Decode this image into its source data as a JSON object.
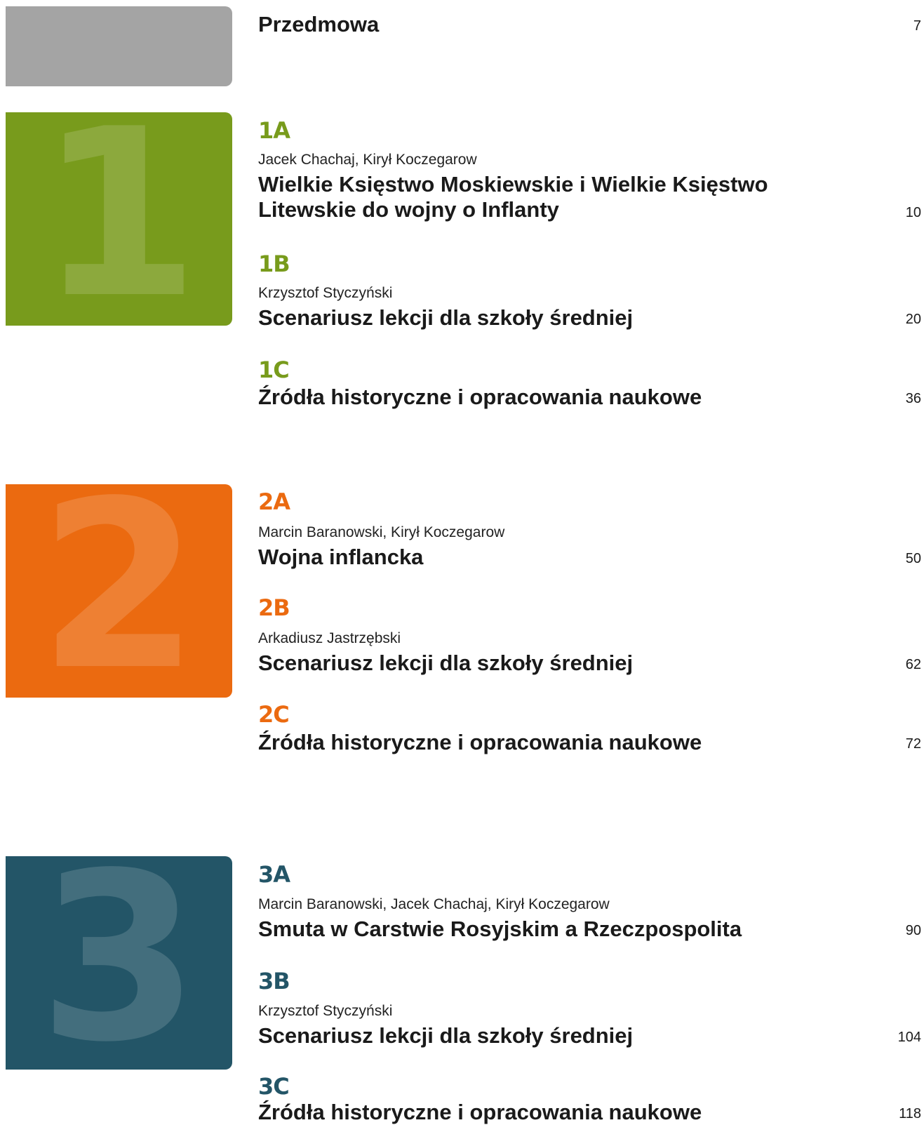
{
  "colors": {
    "preface_block": "#a4a4a4",
    "chapter1": "#789b1c",
    "chapter2": "#eb6a10",
    "chapter3": "#235567"
  },
  "preface": {
    "title": "Przedmowa",
    "page": "7"
  },
  "chapters": [
    {
      "number": "1",
      "sections": [
        {
          "code": "1A",
          "author": "Jacek Chachaj, Kirył Koczegarow",
          "title": "Wielkie Księstwo Moskiewskie i Wielkie Księstwo Litewskie do wojny o Inflanty",
          "page": "10"
        },
        {
          "code": "1B",
          "author": "Krzysztof Styczyński",
          "title": "Scenariusz lekcji dla szkoły średniej",
          "page": "20"
        },
        {
          "code": "1C",
          "title": "Źródła historyczne i opracowania naukowe",
          "page": "36"
        }
      ]
    },
    {
      "number": "2",
      "sections": [
        {
          "code": "2A",
          "author": "Marcin Baranowski, Kirył Koczegarow",
          "title": "Wojna inflancka",
          "page": "50"
        },
        {
          "code": "2B",
          "author": "Arkadiusz Jastrzębski",
          "title": "Scenariusz lekcji dla szkoły średniej",
          "page": "62"
        },
        {
          "code": "2C",
          "title": "Źródła historyczne i opracowania naukowe",
          "page": "72"
        }
      ]
    },
    {
      "number": "3",
      "sections": [
        {
          "code": "3A",
          "author": "Marcin Baranowski, Jacek Chachaj, Kirył Koczegarow",
          "title": "Smuta w Carstwie Rosyjskim a Rzeczpospolita",
          "page": "90"
        },
        {
          "code": "3B",
          "author": "Krzysztof Styczyński",
          "title": "Scenariusz lekcji dla szkoły średniej",
          "page": "104"
        },
        {
          "code": "3C",
          "title": "Źródła historyczne i opracowania naukowe",
          "page": "118"
        }
      ]
    }
  ]
}
